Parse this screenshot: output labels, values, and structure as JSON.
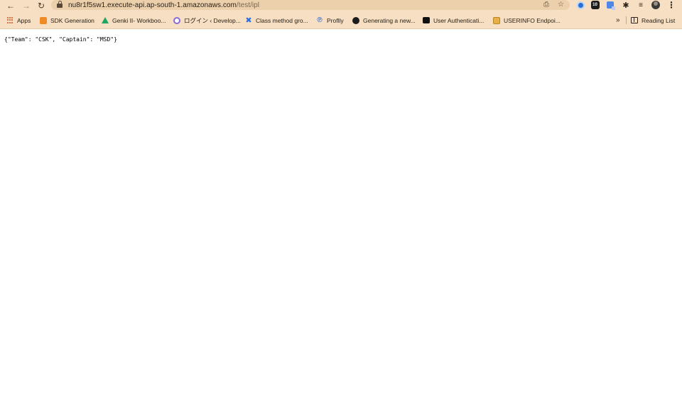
{
  "browser": {
    "url_host": "nu8r1f5sw1.execute-api.ap-south-1.amazonaws.com",
    "url_path": "/test/ipl",
    "extension_badge": "10",
    "icons": {
      "back": "arrow-left-icon",
      "forward": "arrow-right-icon",
      "reload": "reload-icon",
      "lock": "lock-icon",
      "share": "share-icon",
      "bookmark_star": "star-icon",
      "extensions": "puzzle-icon",
      "reading_queue": "queue-icon",
      "menu": "kebab-menu-icon"
    }
  },
  "bookmarks": {
    "items": [
      {
        "label": "Apps",
        "icon": "apps-grid-icon"
      },
      {
        "label": "SDK Generation",
        "icon": "cube-icon"
      },
      {
        "label": "Genki II- Workboo...",
        "icon": "google-drive-icon"
      },
      {
        "label": "ログイン ‹ Develop...",
        "icon": "wordpress-icon"
      },
      {
        "label": "Class method gro...",
        "icon": "x-logo-icon"
      },
      {
        "label": "Proflly",
        "icon": "p-logo-icon"
      },
      {
        "label": "Generating a new...",
        "icon": "github-icon"
      },
      {
        "label": "User Authenticati...",
        "icon": "dev-logo-icon"
      },
      {
        "label": "USERINFO Endpoi...",
        "icon": "stack-icon"
      }
    ],
    "overflow": "»",
    "reading_list": "Reading List"
  },
  "page": {
    "json_text": "{\"Team\": \"CSK\", \"Captain\": \"MSD\"}"
  },
  "colors": {
    "chrome_bg": "#f6dfc2",
    "omnibox_bg": "#ecd0ac",
    "page_bg": "#ffffff"
  }
}
